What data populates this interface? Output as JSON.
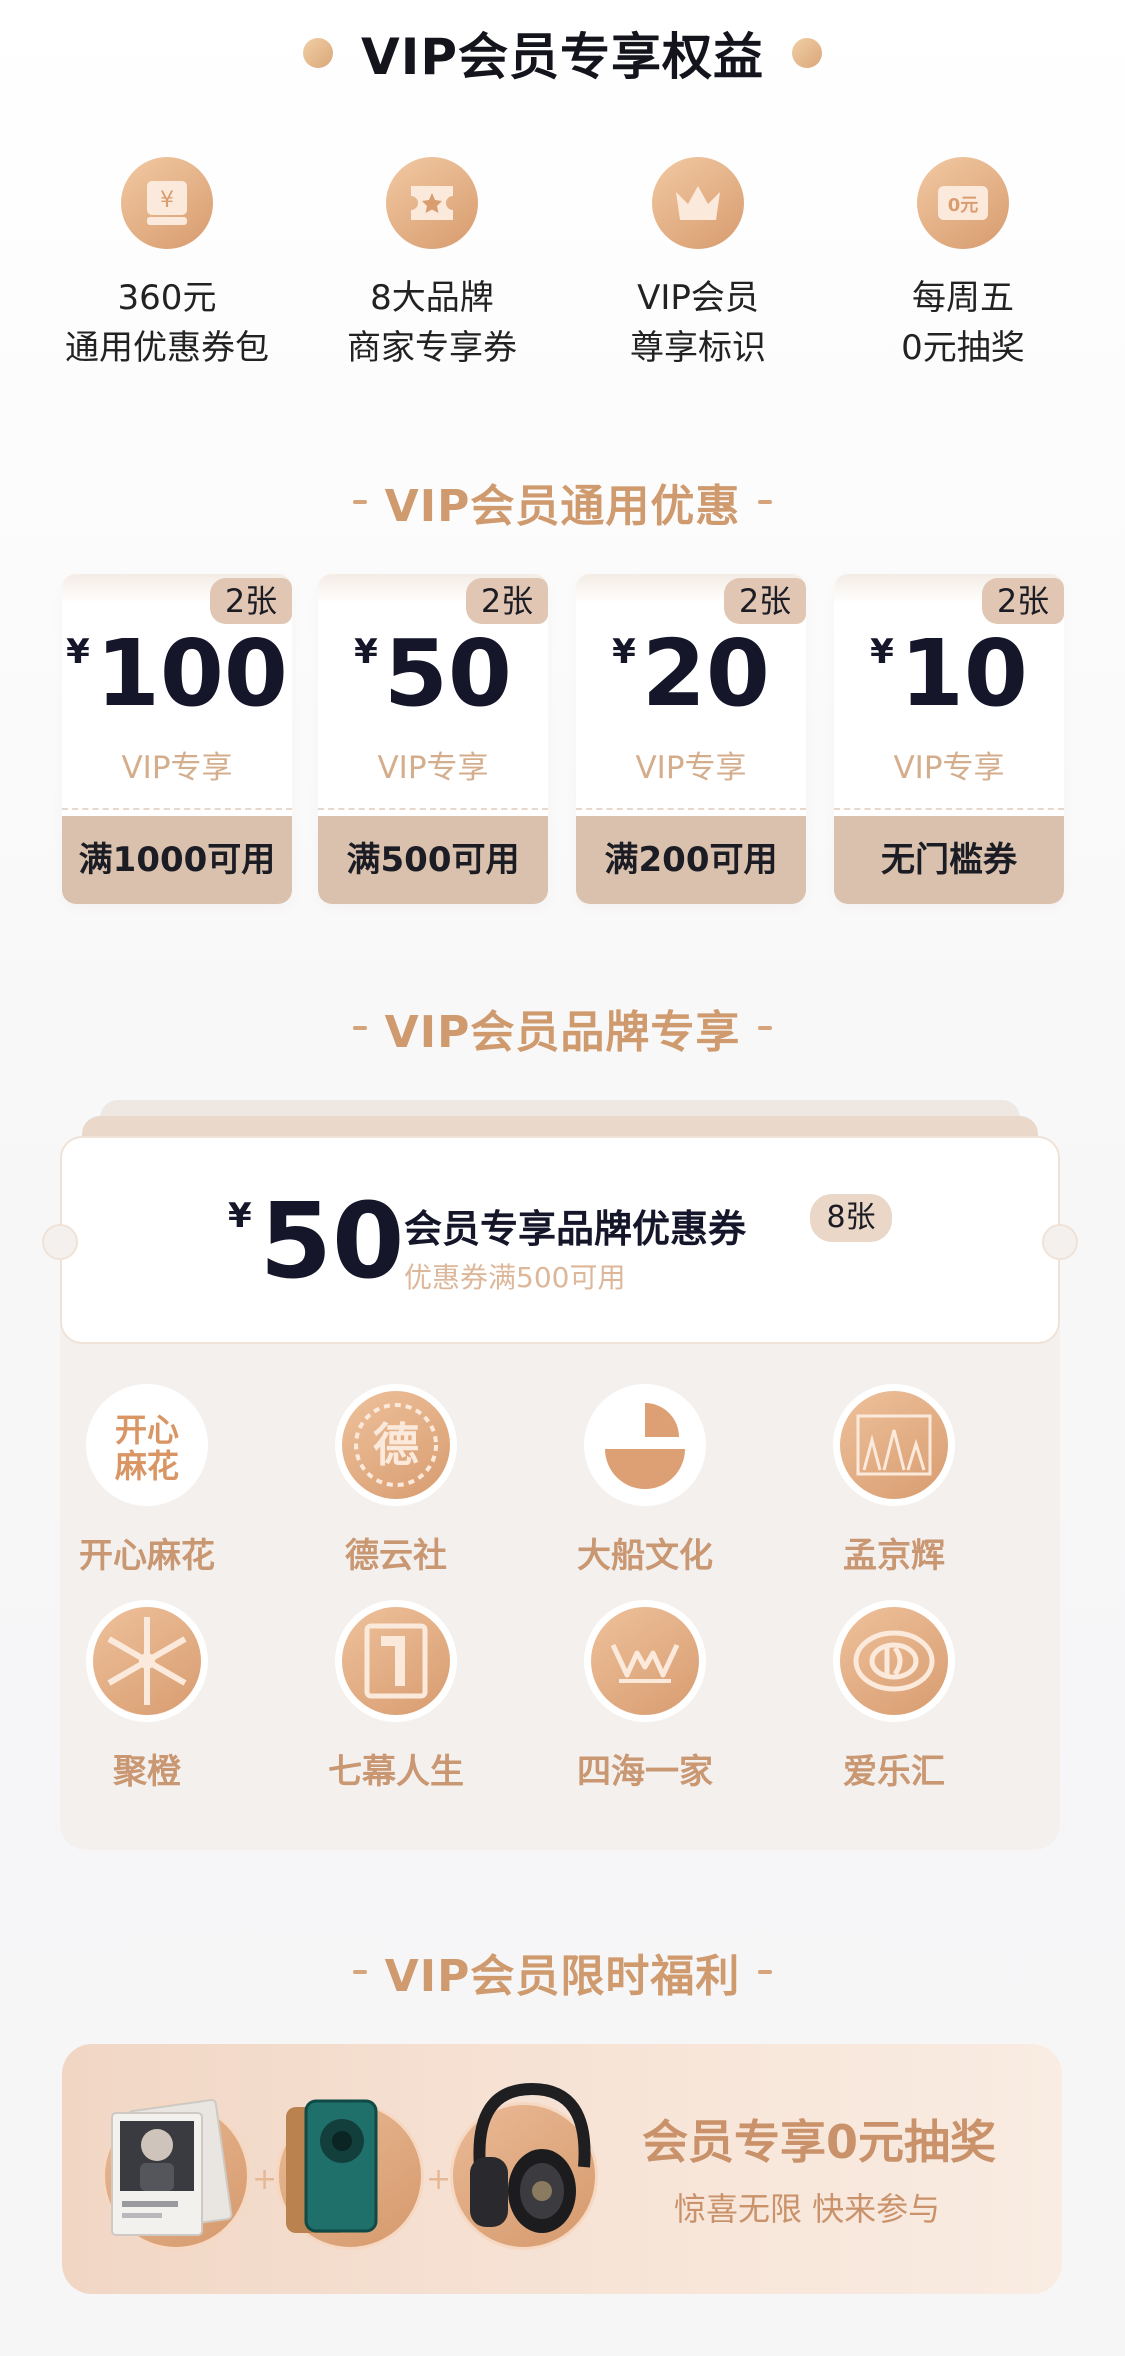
{
  "header": {
    "title": "VIP会员专享权益"
  },
  "benefits": [
    {
      "line1": "360元",
      "line2": "通用优惠券包",
      "icon": "coupon-yen-icon"
    },
    {
      "line1": "8大品牌",
      "line2": "商家专享券",
      "icon": "star-ticket-icon"
    },
    {
      "line1": "VIP会员",
      "line2": "尊享标识",
      "icon": "crown-icon"
    },
    {
      "line1": "每周五",
      "line2": "0元抽奖",
      "icon": "zero-yuan-ticket-icon",
      "icon_text": "0元"
    }
  ],
  "sections": {
    "general": "VIP会员通用优惠",
    "brand": "VIP会员品牌专享",
    "limited": "VIP会员限时福利"
  },
  "coupons": [
    {
      "badge": "2张",
      "currency": "¥",
      "amount": "100",
      "tag": "VIP专享",
      "condition": "满1000可用"
    },
    {
      "badge": "2张",
      "currency": "¥",
      "amount": "50",
      "tag": "VIP专享",
      "condition": "满500可用"
    },
    {
      "badge": "2张",
      "currency": "¥",
      "amount": "20",
      "tag": "VIP专享",
      "condition": "满200可用"
    },
    {
      "badge": "2张",
      "currency": "¥",
      "amount": "10",
      "tag": "VIP专享",
      "condition": "无门槛券"
    }
  ],
  "brand_coupon": {
    "currency": "¥",
    "amount": "50",
    "title": "会员专享品牌优惠券",
    "badge": "8张",
    "subtitle": "优惠券满500可用"
  },
  "brands": [
    {
      "name": "开心麻花",
      "logo_text": "开心麻花"
    },
    {
      "name": "德云社",
      "logo_text": "德"
    },
    {
      "name": "大船文化",
      "logo_text": ""
    },
    {
      "name": "孟京辉",
      "logo_text": ""
    },
    {
      "name": "聚橙",
      "logo_text": ""
    },
    {
      "name": "七幕人生",
      "logo_text": ""
    },
    {
      "name": "四海一家",
      "logo_text": ""
    },
    {
      "name": "爱乐汇",
      "logo_text": ""
    }
  ],
  "lottery": {
    "title": "会员专享0元抽奖",
    "subtitle": "惊喜无限 快来参与",
    "plus": "+",
    "prizes": [
      "photo-album-icon",
      "smartphone-icon",
      "headphones-icon"
    ]
  },
  "colors": {
    "accent": "#cf9a6e",
    "coupon_footer": "#d9c1ae",
    "icon_gradient_start": "#f2c9a3",
    "icon_gradient_end": "#d79b6e"
  }
}
